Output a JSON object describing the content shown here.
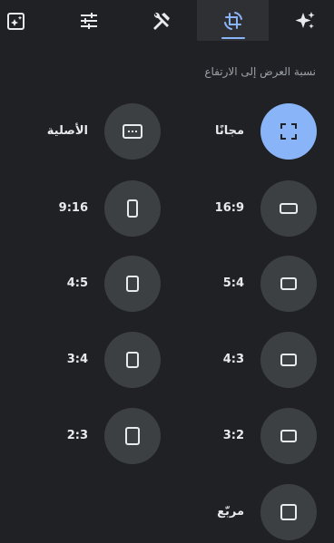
{
  "toolbar": {
    "tools": [
      {
        "icon": "auto-enhance-icon"
      },
      {
        "icon": "adjust-sliders-icon"
      },
      {
        "icon": "tools-icon"
      },
      {
        "icon": "crop-rotate-icon",
        "active": true
      },
      {
        "icon": "sparkle-icon"
      }
    ],
    "active_color": "#8ab4f8"
  },
  "aspect_ratio": {
    "title": "نسبة العرض إلى الارتفاع",
    "options": [
      {
        "label": "مجانًا",
        "icon": "free-crop-icon",
        "selected": true
      },
      {
        "label": "الأصلية",
        "icon": "original-image-icon"
      },
      {
        "label": "16:9",
        "icon": "landscape-rect-icon"
      },
      {
        "label": "9:16",
        "icon": "portrait-rect-icon"
      },
      {
        "label": "5:4",
        "icon": "landscape-rect-icon"
      },
      {
        "label": "4:5",
        "icon": "portrait-rect-icon"
      },
      {
        "label": "4:3",
        "icon": "landscape-rect-icon"
      },
      {
        "label": "3:4",
        "icon": "portrait-rect-icon"
      },
      {
        "label": "3:2",
        "icon": "landscape-rect-icon"
      },
      {
        "label": "2:3",
        "icon": "portrait-rect-icon"
      },
      {
        "label": "مربّع",
        "icon": "square-icon"
      }
    ]
  },
  "colors": {
    "background": "#202124",
    "circle": "#3c4043",
    "selected_circle": "#8ab4f8",
    "text": "#e8eaed",
    "muted_text": "#9aa0a6"
  }
}
